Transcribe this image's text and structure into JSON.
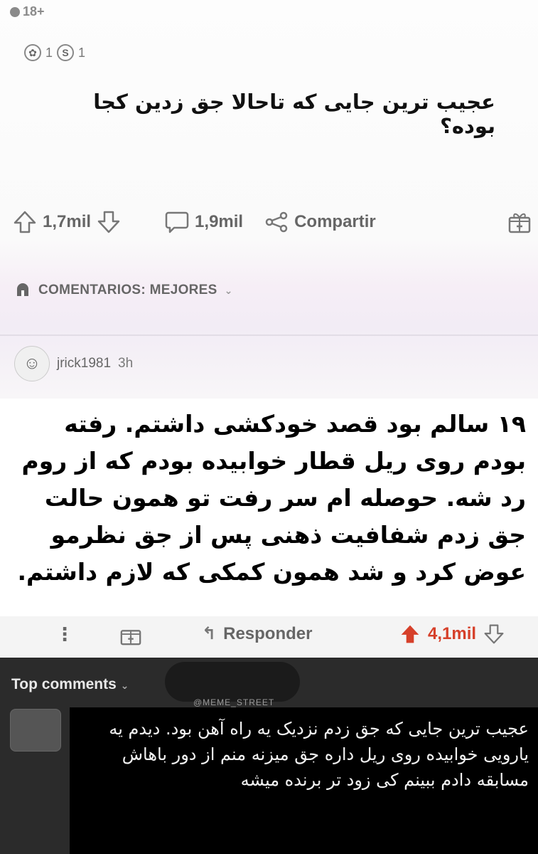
{
  "post": {
    "nsfw_badge": "18+",
    "awards": [
      {
        "icon": "award-icon",
        "count": "1"
      },
      {
        "icon": "silver-award-icon",
        "count": "1"
      }
    ],
    "title": "عجیب ترین جایی که تاحالا جق زدین کجا بوده؟"
  },
  "actions": {
    "upvotes": "1,7mil",
    "comments": "1,9mil",
    "share_label": "Compartir"
  },
  "sort": {
    "label": "COMENTARIOS: MEJORES"
  },
  "comment": {
    "username": "jrick1981",
    "time": "3h",
    "text": "۱۹ سالم بود قصد خودکشی داشتم. رفته بودم روی ریل قطار خوابیده بودم که از روم رد شه. حوصله ام سر رفت تو همون حالت جق زدم شفافیت ذهنی پس از جق نظرمو عوض کرد و شد همون کمکی که لازم داشتم.",
    "reply_label": "Responder",
    "score": "4,1mil"
  },
  "second": {
    "header": "Top comments",
    "watermark": "@MEME_STREET",
    "text": "عجیب ترین جایی که جق زدم نزدیک یه راه آهن بود. دیدم یه یارویی خوابیده روی ریل داره جق میزنه منم از دور باهاش مسابقه دادم ببینم کی زود تر برنده میشه"
  }
}
